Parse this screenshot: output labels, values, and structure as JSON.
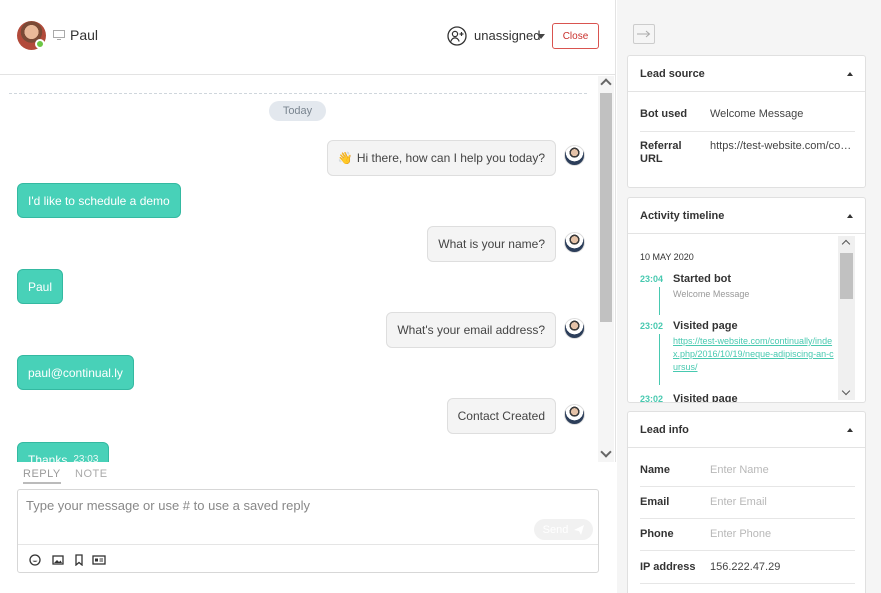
{
  "header": {
    "contact_name": "Paul",
    "assignee": "unassigned",
    "close_label": "Close"
  },
  "conversation": {
    "day_label": "Today",
    "messages": [
      {
        "from": "bot",
        "emoji": "👋",
        "text": "Hi there, how can I help you today?"
      },
      {
        "from": "user",
        "text": "I'd like to schedule a demo"
      },
      {
        "from": "bot",
        "text": "What is your name?"
      },
      {
        "from": "user",
        "text": "Paul"
      },
      {
        "from": "bot",
        "text": "What's your email address?"
      },
      {
        "from": "user",
        "text": "paul@continual.ly"
      },
      {
        "from": "bot",
        "text": "Contact Created"
      },
      {
        "from": "user",
        "text": "Thanks",
        "time": "23:03"
      }
    ]
  },
  "composer": {
    "tabs": [
      "REPLY",
      "NOTE"
    ],
    "placeholder": "Type your message or use # to use a saved reply",
    "send_label": "Send",
    "tools": [
      "emoji-icon",
      "image-icon",
      "bookmark-icon",
      "card-icon"
    ]
  },
  "lead_source": {
    "title": "Lead source",
    "rows": [
      {
        "label": "Bot used",
        "value": "Welcome Message"
      },
      {
        "label": "Referral URL",
        "value": "https://test-website.com/continually"
      }
    ]
  },
  "activity": {
    "title": "Activity timeline",
    "date": "10 MAY 2020",
    "events": [
      {
        "time": "23:04",
        "title": "Started bot",
        "detail": "Welcome Message"
      },
      {
        "time": "23:02",
        "title": "Visited page",
        "link": "https://test-website.com/continually/index.php/2016/10/19/neque-adipiscing-an-cursus/"
      },
      {
        "time": "23:02",
        "title": "Visited page"
      }
    ]
  },
  "lead_info": {
    "title": "Lead info",
    "rows": [
      {
        "label": "Name",
        "value": "Enter Name",
        "placeholder": true
      },
      {
        "label": "Email",
        "value": "Enter Email",
        "placeholder": true
      },
      {
        "label": "Phone",
        "value": "Enter Phone",
        "placeholder": true
      },
      {
        "label": "IP address",
        "value": "156.222.47.29",
        "placeholder": false
      }
    ]
  },
  "colors": {
    "accent": "#48d1b8",
    "close": "#d9534f",
    "online": "#6cc644"
  }
}
